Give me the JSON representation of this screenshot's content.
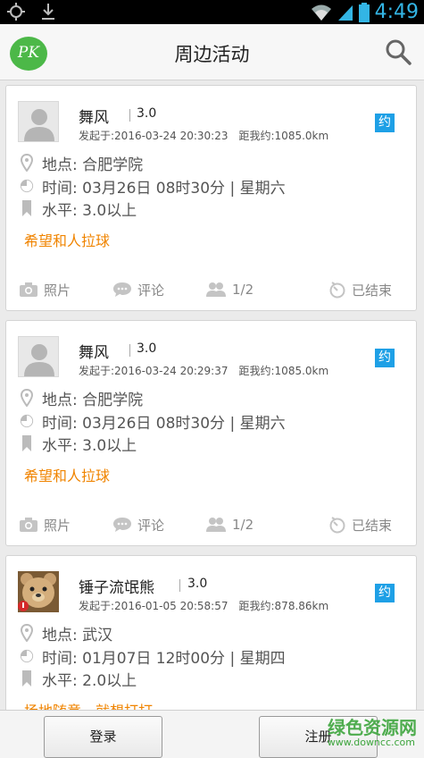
{
  "status_bar": {
    "time": "4:49"
  },
  "header": {
    "title": "周边活动",
    "logo_text": "PK"
  },
  "cards": [
    {
      "user_name": "舞风",
      "score": "3.0",
      "posted": "发起于:2016-03-24 20:30:23",
      "distance": "距我约:1085.0km",
      "badge": "约",
      "location": "地点: 合肥学院",
      "time": "时间: 03月26日 08时30分 | 星期六",
      "level": "水平: 3.0以上",
      "description": "希望和人拉球",
      "photo_label": "照片",
      "comment_label": "评论",
      "people": "1/2",
      "status": "已结束"
    },
    {
      "user_name": "舞风",
      "score": "3.0",
      "posted": "发起于:2016-03-24 20:29:37",
      "distance": "距我约:1085.0km",
      "badge": "约",
      "location": "地点: 合肥学院",
      "time": "时间: 03月26日 08时30分 | 星期六",
      "level": "水平: 3.0以上",
      "description": "希望和人拉球",
      "photo_label": "照片",
      "comment_label": "评论",
      "people": "1/2",
      "status": "已结束"
    },
    {
      "user_name": "锤子流氓熊",
      "score": "3.0",
      "posted": "发起于:2016-01-05 20:58:57",
      "distance": "距我约:878.86km",
      "badge": "约",
      "location": "地点: 武汉",
      "time": "时间: 01月07日 12时00分 | 星期四",
      "level": "水平: 2.0以上",
      "description": "场地随意，就想打打"
    }
  ],
  "bottom_bar": {
    "login_label": "登录",
    "register_label": "注册"
  },
  "watermark": {
    "main": "绿色资源网",
    "sub": "www.downcc.com"
  },
  "colors": {
    "accent": "#1ea0e6",
    "highlight": "#f08400",
    "logo": "#4cb848",
    "status_icons": "#33b5e5"
  }
}
